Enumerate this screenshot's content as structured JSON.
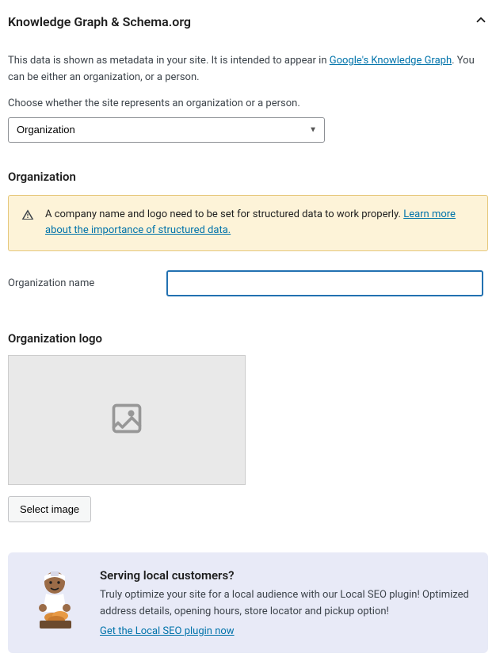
{
  "header": {
    "title": "Knowledge Graph & Schema.org"
  },
  "intro": {
    "text_before_link": "This data is shown as metadata in your site. It is intended to appear in ",
    "link_text": "Google's Knowledge Graph",
    "text_after_link": ". You can be either an organization, or a person."
  },
  "site_type": {
    "prompt": "Choose whether the site represents an organization or a person.",
    "selected": "Organization"
  },
  "org_section": {
    "title": "Organization",
    "alert_text": "A company name and logo need to be set for structured data to work properly. ",
    "alert_link": "Learn more about the importance of structured data.",
    "name_label": "Organization name",
    "name_value": "",
    "logo_label": "Organization logo",
    "select_image_btn": "Select image"
  },
  "promo": {
    "title": "Serving local customers?",
    "body": "Truly optimize your site for a local audience with our Local SEO plugin! Optimized address details, opening hours, store locator and pickup option!",
    "cta": "Get the Local SEO plugin now"
  }
}
